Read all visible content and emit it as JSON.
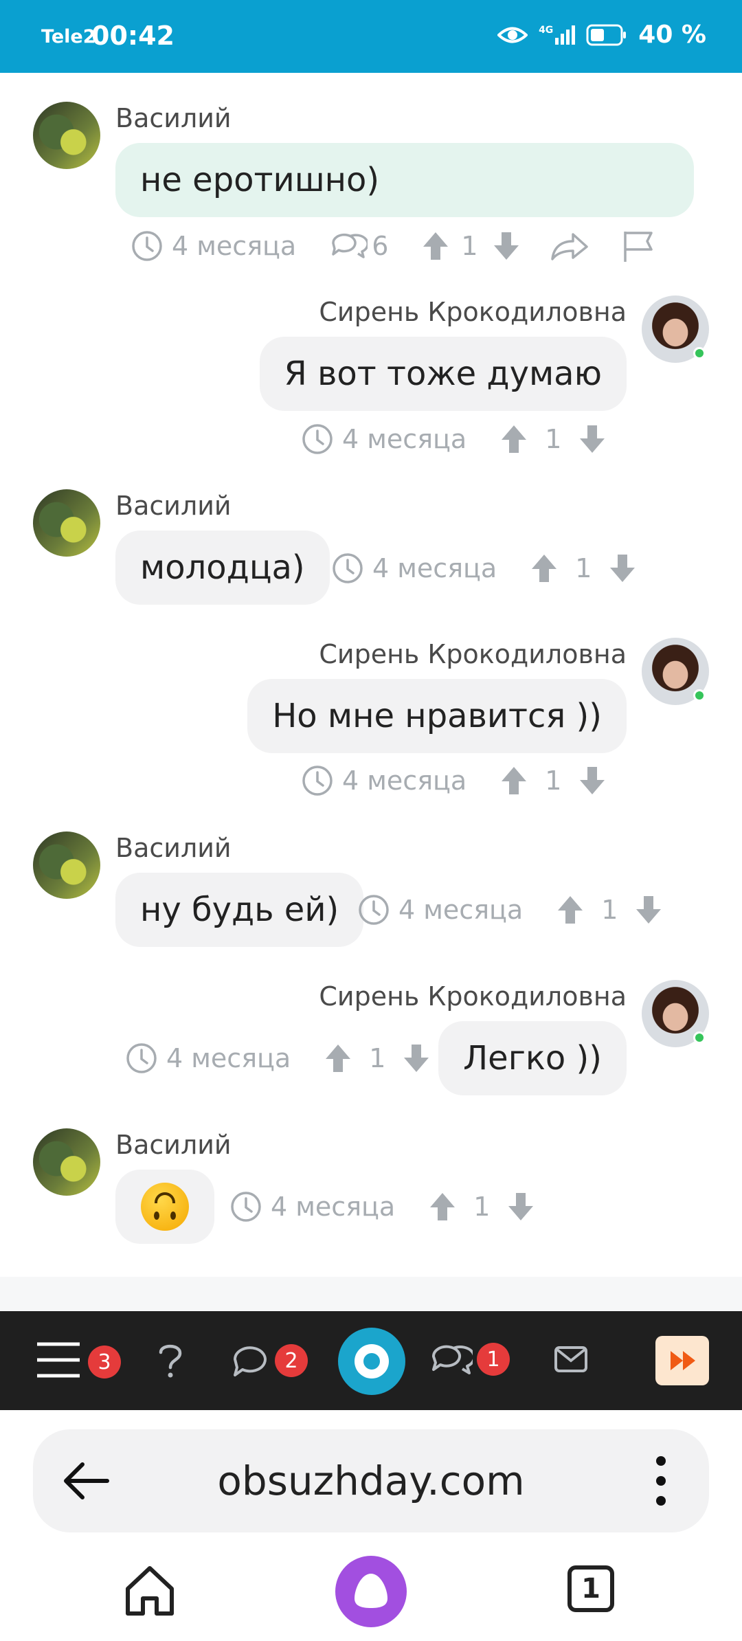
{
  "status_bar": {
    "carrier": "Tele2",
    "time": "00:42",
    "network": "4G",
    "battery": "40 %"
  },
  "comments": [
    {
      "author": "Василий",
      "text": "не еротишно)",
      "time": "4 месяца",
      "replies": "6",
      "votes": "1",
      "side": "left",
      "highlighted": true
    },
    {
      "author": "Сирень Крокодиловна",
      "text": "Я вот тоже думаю",
      "time": "4 месяца",
      "votes": "1",
      "side": "right"
    },
    {
      "author": "Василий",
      "text": "молодца)",
      "time": "4 месяца",
      "votes": "1",
      "side": "left"
    },
    {
      "author": "Сирень Крокодиловна",
      "text": "Но мне нравится ))",
      "time": "4 месяца",
      "votes": "1",
      "side": "right"
    },
    {
      "author": "Василий",
      "text": "ну будь ей)",
      "time": "4 месяца",
      "votes": "1",
      "side": "left"
    },
    {
      "author": "Сирень Крокодиловна",
      "text": "Легко ))",
      "time": "4 месяца",
      "votes": "1",
      "side": "right"
    },
    {
      "author": "Василий",
      "emoji": "upside-down-face",
      "time": "4 месяца",
      "votes": "1",
      "side": "left"
    }
  ],
  "nav_bar": {
    "menu_badge": "3",
    "chat_badge": "2",
    "comments_badge": "1"
  },
  "browser": {
    "url": "obsuzhday.com",
    "tabs_count": "1"
  },
  "colors": {
    "status_bar": "#0aa0d0",
    "highlight_bubble": "#e4f4ee",
    "bubble": "#f2f2f3",
    "badge": "#e53b3b",
    "nav_bar": "#1f1f1f",
    "online_dot": "#35c45a",
    "alice": "#a24fe0"
  }
}
